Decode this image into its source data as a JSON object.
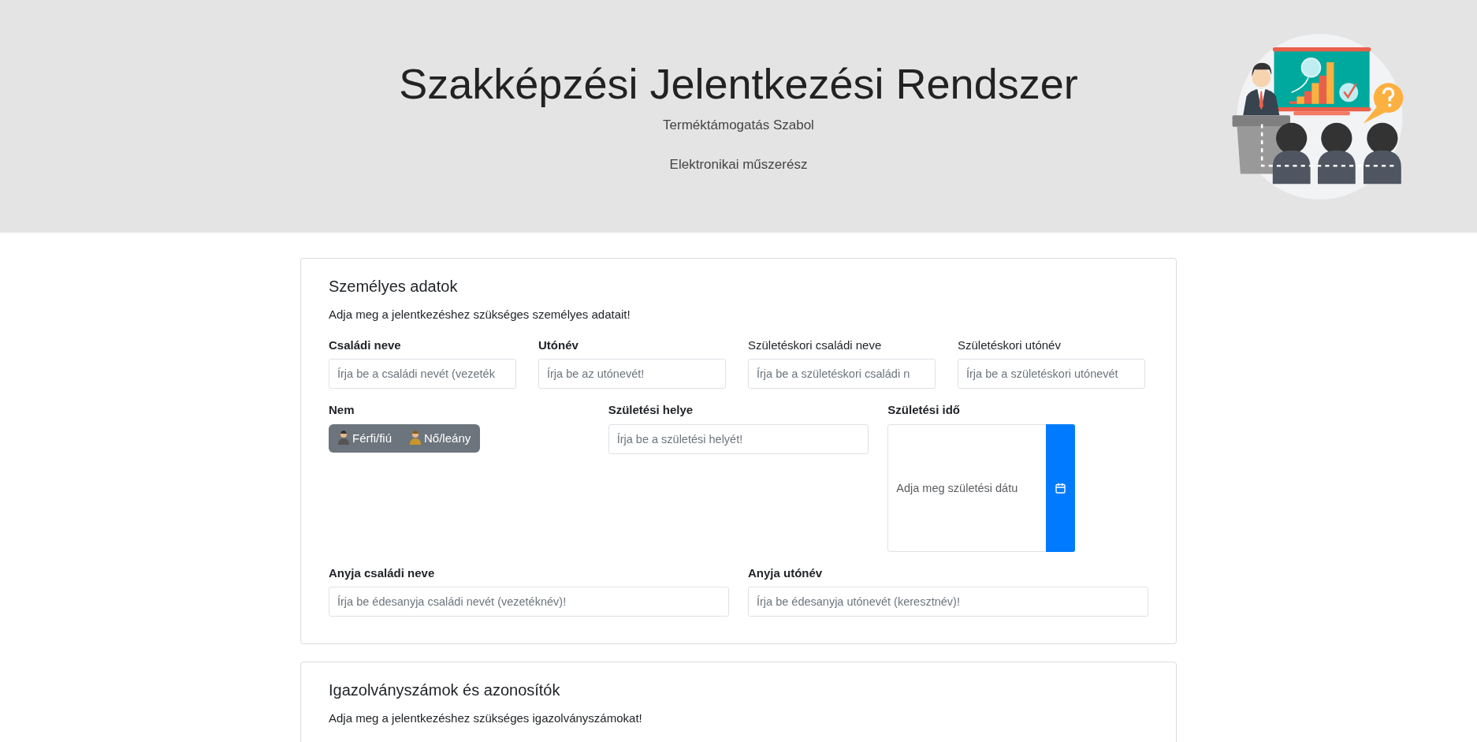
{
  "header": {
    "title": "Szakképzési Jelentkezési Rendszer",
    "subtitle": "Terméktámogatás Szabol",
    "profession": "Elektronikai műszerész"
  },
  "sections": [
    {
      "title": "Személyes adatok",
      "description": "Adja meg a jelentkezéshez szükséges személyes adatait!",
      "rows": [
        [
          {
            "kind": "text",
            "label": "Családi neve",
            "required": true,
            "placeholder": "Írja be a családi nevét (vezeték"
          },
          {
            "kind": "text",
            "label": "Utónév",
            "required": true,
            "placeholder": "Írja be az utónevét!"
          },
          {
            "kind": "text",
            "label": "Születéskori családi neve",
            "required": false,
            "placeholder": "Írja be a születéskori családi n"
          },
          {
            "kind": "text",
            "label": "Születéskori utónév",
            "required": false,
            "placeholder": "Írja be a születéskori utónevét"
          }
        ],
        [
          {
            "kind": "toggle",
            "label": "Nem",
            "required": true,
            "options": [
              {
                "label": "Férfi/fiú",
                "selected": false
              },
              {
                "label": "Nő/leány",
                "selected": false
              }
            ]
          },
          {
            "kind": "text",
            "label": "Születési helye",
            "required": true,
            "placeholder": "Írja be a születési helyét!"
          },
          {
            "kind": "date",
            "label": "Születési idő",
            "required": true,
            "placeholder": "Adja meg születési dátu"
          }
        ],
        [
          {
            "kind": "text",
            "label": "Anyja családi neve",
            "required": true,
            "placeholder": "Írja be édesanyja családi nevét (vezetéknév)!"
          },
          {
            "kind": "text",
            "label": "Anyja utónév",
            "required": true,
            "placeholder": "Írja be édesanyja utónevét (keresztnév)!"
          }
        ]
      ]
    },
    {
      "title": "Igazolványszámok és azonosítók",
      "description": "Adja meg a jelentkezéshez szükséges igazolványszámokat!"
    }
  ]
}
